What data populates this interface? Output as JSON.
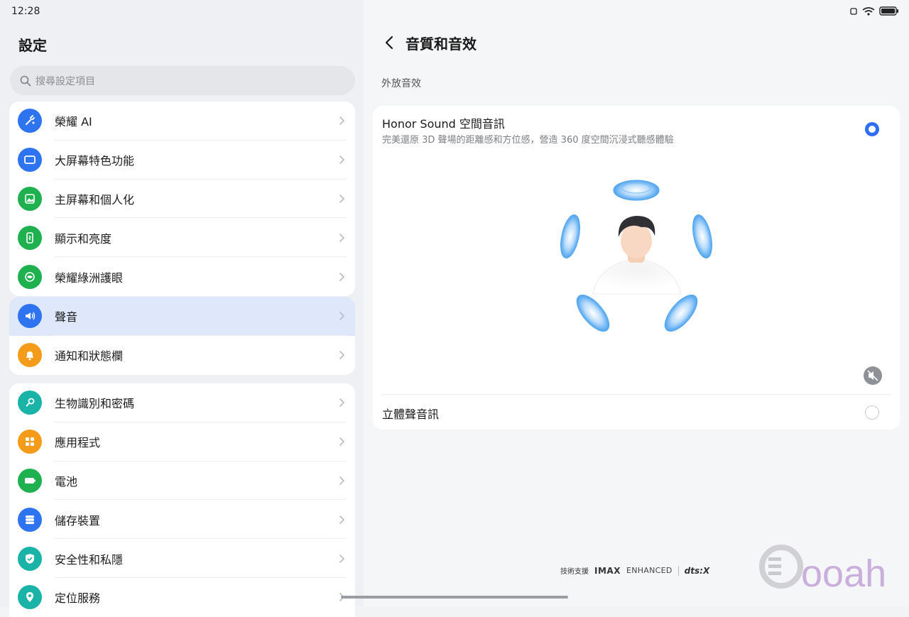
{
  "status_bar": {
    "time": "12:28"
  },
  "left_panel": {
    "title": "設定",
    "search": {
      "placeholder": "搜尋設定項目"
    },
    "groups": [
      {
        "items": [
          {
            "label": "榮耀 AI",
            "icon": "ai-sparkle-icon",
            "color": "#2e73f0"
          },
          {
            "label": "大屏幕特色功能",
            "icon": "tablet-icon",
            "color": "#2e73f0"
          },
          {
            "label": "主屏幕和個人化",
            "icon": "image-icon",
            "color": "#1fb14f"
          },
          {
            "label": "顯示和亮度",
            "icon": "phone-brightness-icon",
            "color": "#1fb14f"
          },
          {
            "label": "榮耀綠洲護眼",
            "icon": "eye-care-icon",
            "color": "#1fb14f"
          }
        ]
      },
      {
        "items": [
          {
            "label": "聲音",
            "icon": "speaker-icon",
            "color": "#2e73f0",
            "active": true
          },
          {
            "label": "通知和狀態欄",
            "icon": "bell-icon",
            "color": "#f59b1a"
          }
        ]
      },
      {
        "items": [
          {
            "label": "生物識別和密碼",
            "icon": "key-icon",
            "color": "#19b3a8"
          },
          {
            "label": "應用程式",
            "icon": "apps-grid-icon",
            "color": "#f59b1a"
          },
          {
            "label": "電池",
            "icon": "battery-icon",
            "color": "#1fb14f"
          },
          {
            "label": "儲存裝置",
            "icon": "storage-icon",
            "color": "#2e73f0"
          },
          {
            "label": "安全性和私隱",
            "icon": "shield-check-icon",
            "color": "#19b3a8"
          },
          {
            "label": "定位服務",
            "icon": "location-pin-icon",
            "color": "#19b3a8"
          }
        ]
      }
    ]
  },
  "right_panel": {
    "title": "音質和音效",
    "section_label": "外放音效",
    "options": [
      {
        "title": "Honor Sound 空間音訊",
        "description": "完美還原 3D 聲場的距離感和方位感，營造 360 度空間沉浸式聽感體驗",
        "selected": true
      },
      {
        "title": "立體聲音訊",
        "selected": false
      }
    ],
    "powered_by": {
      "prefix": "技術支援",
      "imax": "IMAX",
      "enhanced": "ENHANCED",
      "dts": "dts:X"
    }
  },
  "watermark": {
    "text": "ooah"
  },
  "colors": {
    "accent": "#2f6ef4",
    "active_row": "#dfe8fb"
  }
}
